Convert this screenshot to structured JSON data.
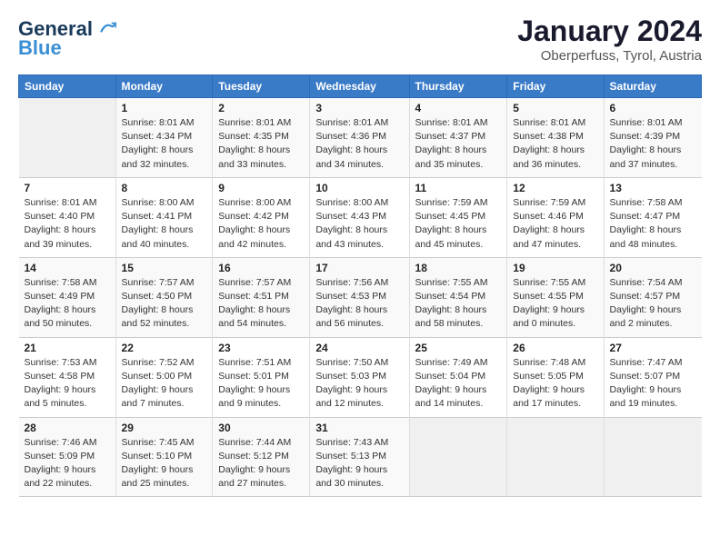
{
  "header": {
    "logo_line1": "General",
    "logo_line2": "Blue",
    "month_title": "January 2024",
    "subtitle": "Oberperfuss, Tyrol, Austria"
  },
  "columns": [
    "Sunday",
    "Monday",
    "Tuesday",
    "Wednesday",
    "Thursday",
    "Friday",
    "Saturday"
  ],
  "weeks": [
    [
      {
        "day": "",
        "empty": true
      },
      {
        "day": "1",
        "sunrise": "8:01 AM",
        "sunset": "4:34 PM",
        "daylight": "8 hours and 32 minutes."
      },
      {
        "day": "2",
        "sunrise": "8:01 AM",
        "sunset": "4:35 PM",
        "daylight": "8 hours and 33 minutes."
      },
      {
        "day": "3",
        "sunrise": "8:01 AM",
        "sunset": "4:36 PM",
        "daylight": "8 hours and 34 minutes."
      },
      {
        "day": "4",
        "sunrise": "8:01 AM",
        "sunset": "4:37 PM",
        "daylight": "8 hours and 35 minutes."
      },
      {
        "day": "5",
        "sunrise": "8:01 AM",
        "sunset": "4:38 PM",
        "daylight": "8 hours and 36 minutes."
      },
      {
        "day": "6",
        "sunrise": "8:01 AM",
        "sunset": "4:39 PM",
        "daylight": "8 hours and 37 minutes."
      }
    ],
    [
      {
        "day": "7",
        "sunrise": "8:01 AM",
        "sunset": "4:40 PM",
        "daylight": "8 hours and 39 minutes."
      },
      {
        "day": "8",
        "sunrise": "8:00 AM",
        "sunset": "4:41 PM",
        "daylight": "8 hours and 40 minutes."
      },
      {
        "day": "9",
        "sunrise": "8:00 AM",
        "sunset": "4:42 PM",
        "daylight": "8 hours and 42 minutes."
      },
      {
        "day": "10",
        "sunrise": "8:00 AM",
        "sunset": "4:43 PM",
        "daylight": "8 hours and 43 minutes."
      },
      {
        "day": "11",
        "sunrise": "7:59 AM",
        "sunset": "4:45 PM",
        "daylight": "8 hours and 45 minutes."
      },
      {
        "day": "12",
        "sunrise": "7:59 AM",
        "sunset": "4:46 PM",
        "daylight": "8 hours and 47 minutes."
      },
      {
        "day": "13",
        "sunrise": "7:58 AM",
        "sunset": "4:47 PM",
        "daylight": "8 hours and 48 minutes."
      }
    ],
    [
      {
        "day": "14",
        "sunrise": "7:58 AM",
        "sunset": "4:49 PM",
        "daylight": "8 hours and 50 minutes."
      },
      {
        "day": "15",
        "sunrise": "7:57 AM",
        "sunset": "4:50 PM",
        "daylight": "8 hours and 52 minutes."
      },
      {
        "day": "16",
        "sunrise": "7:57 AM",
        "sunset": "4:51 PM",
        "daylight": "8 hours and 54 minutes."
      },
      {
        "day": "17",
        "sunrise": "7:56 AM",
        "sunset": "4:53 PM",
        "daylight": "8 hours and 56 minutes."
      },
      {
        "day": "18",
        "sunrise": "7:55 AM",
        "sunset": "4:54 PM",
        "daylight": "8 hours and 58 minutes."
      },
      {
        "day": "19",
        "sunrise": "7:55 AM",
        "sunset": "4:55 PM",
        "daylight": "9 hours and 0 minutes."
      },
      {
        "day": "20",
        "sunrise": "7:54 AM",
        "sunset": "4:57 PM",
        "daylight": "9 hours and 2 minutes."
      }
    ],
    [
      {
        "day": "21",
        "sunrise": "7:53 AM",
        "sunset": "4:58 PM",
        "daylight": "9 hours and 5 minutes."
      },
      {
        "day": "22",
        "sunrise": "7:52 AM",
        "sunset": "5:00 PM",
        "daylight": "9 hours and 7 minutes."
      },
      {
        "day": "23",
        "sunrise": "7:51 AM",
        "sunset": "5:01 PM",
        "daylight": "9 hours and 9 minutes."
      },
      {
        "day": "24",
        "sunrise": "7:50 AM",
        "sunset": "5:03 PM",
        "daylight": "9 hours and 12 minutes."
      },
      {
        "day": "25",
        "sunrise": "7:49 AM",
        "sunset": "5:04 PM",
        "daylight": "9 hours and 14 minutes."
      },
      {
        "day": "26",
        "sunrise": "7:48 AM",
        "sunset": "5:05 PM",
        "daylight": "9 hours and 17 minutes."
      },
      {
        "day": "27",
        "sunrise": "7:47 AM",
        "sunset": "5:07 PM",
        "daylight": "9 hours and 19 minutes."
      }
    ],
    [
      {
        "day": "28",
        "sunrise": "7:46 AM",
        "sunset": "5:09 PM",
        "daylight": "9 hours and 22 minutes."
      },
      {
        "day": "29",
        "sunrise": "7:45 AM",
        "sunset": "5:10 PM",
        "daylight": "9 hours and 25 minutes."
      },
      {
        "day": "30",
        "sunrise": "7:44 AM",
        "sunset": "5:12 PM",
        "daylight": "9 hours and 27 minutes."
      },
      {
        "day": "31",
        "sunrise": "7:43 AM",
        "sunset": "5:13 PM",
        "daylight": "9 hours and 30 minutes."
      },
      {
        "day": "",
        "empty": true
      },
      {
        "day": "",
        "empty": true
      },
      {
        "day": "",
        "empty": true
      }
    ]
  ]
}
